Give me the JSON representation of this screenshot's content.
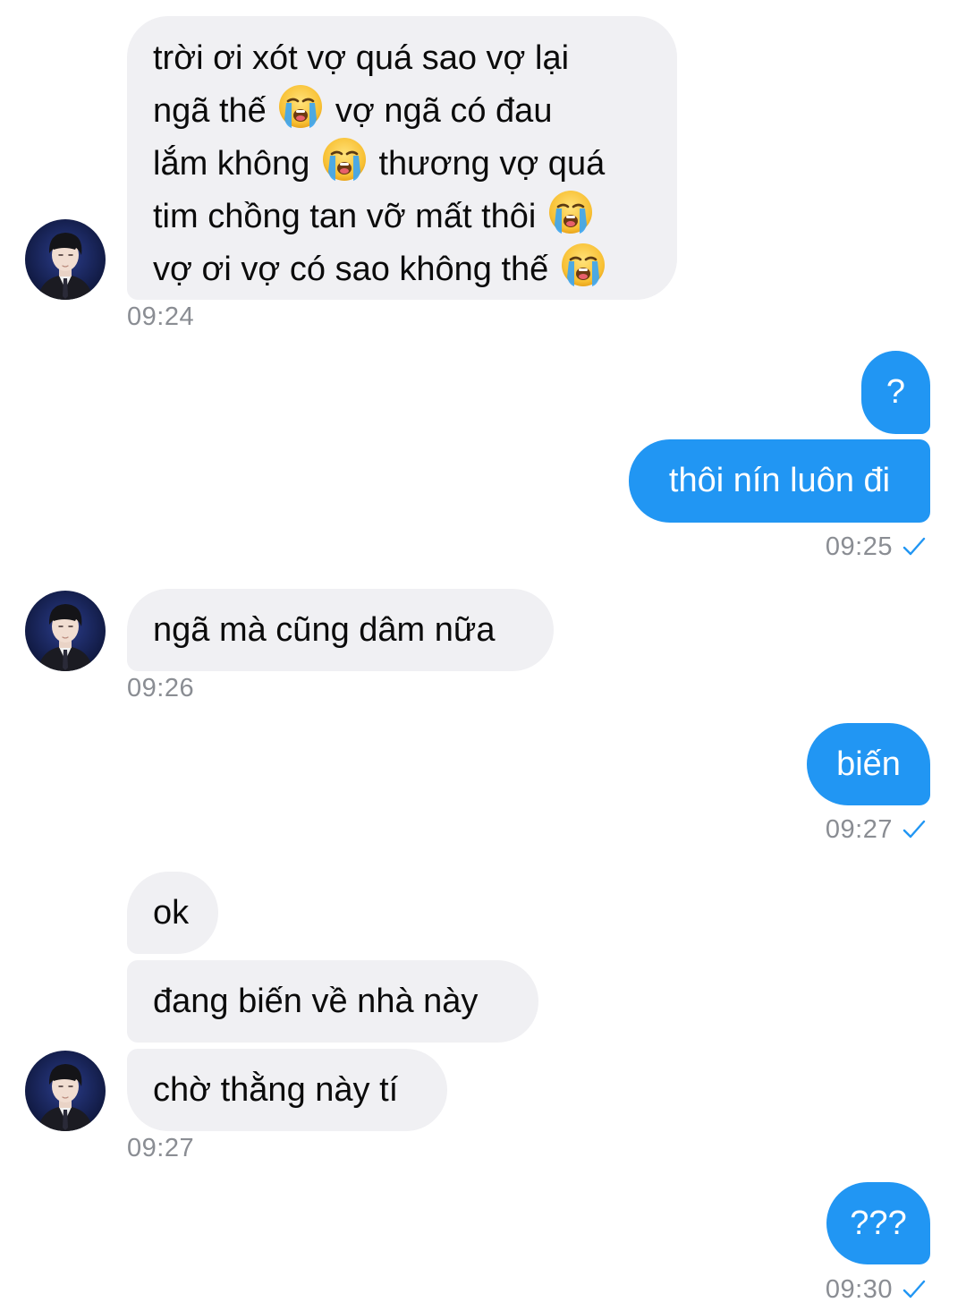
{
  "conversation": {
    "message1": {
      "lines": [
        "trời ơi xót vợ quá sao vợ lại",
        "ngã thế",
        "vợ ngã có đau",
        "lắm không",
        "thương vợ quá",
        "tim chồng tan vỡ mất thôi",
        "vợ ơi vợ có sao không thế"
      ],
      "time": "09:24"
    },
    "message2": {
      "text": "?"
    },
    "message3": {
      "text": "thôi nín luôn đi",
      "time": "09:25"
    },
    "message4": {
      "text": "ngã mà cũng dâm nữa",
      "time": "09:26"
    },
    "message5": {
      "text": "biến",
      "time": "09:27"
    },
    "message6": {
      "text": "ok"
    },
    "message7": {
      "text": "đang biến về nhà này"
    },
    "message8": {
      "text": "chờ thằng này tí",
      "time": "09:27"
    },
    "message9": {
      "text": "???",
      "time": "09:30"
    }
  },
  "icons": {
    "emoji": "loudly-crying-face",
    "read_receipt": "checkmark-icon",
    "avatar": "contact-avatar"
  },
  "colors": {
    "incoming_bubble": "#f0f0f3",
    "outgoing_bubble": "#2196f3",
    "timestamp": "#8a8d93",
    "check": "#2196f3"
  }
}
